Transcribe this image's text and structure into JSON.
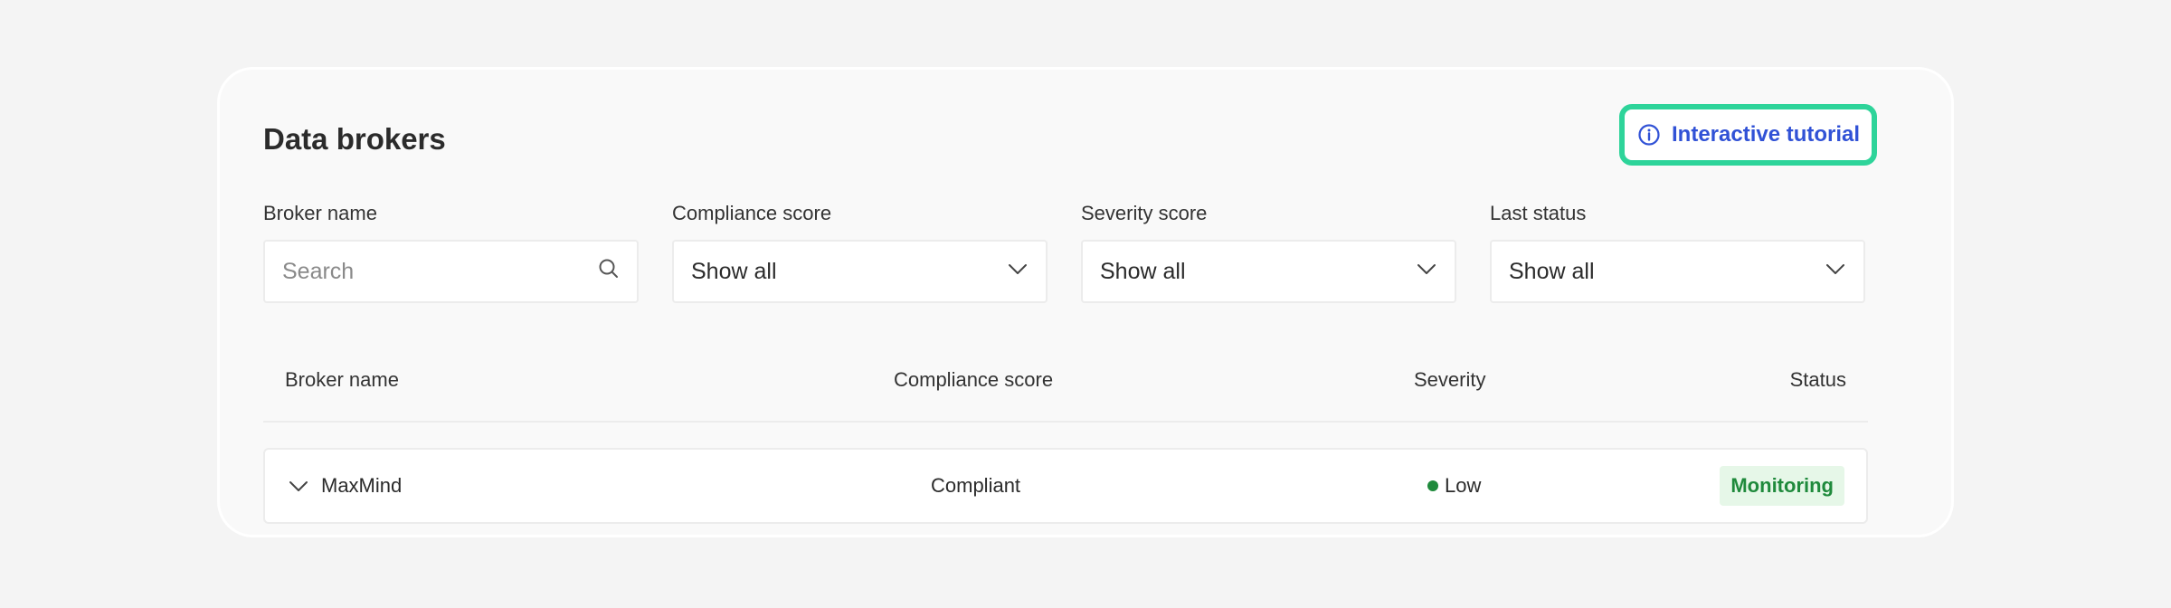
{
  "page": {
    "title": "Data brokers",
    "tutorial_label": "Interactive tutorial"
  },
  "filters": [
    {
      "label": "Broker name",
      "placeholder": "Search",
      "icon": "search-icon"
    },
    {
      "label": "Compliance score",
      "value": "Show all",
      "icon": "chevron-down-icon"
    },
    {
      "label": "Severity score",
      "value": "Show all",
      "icon": "chevron-down-icon"
    },
    {
      "label": "Last status",
      "value": "Show all",
      "icon": "chevron-down-icon"
    }
  ],
  "table": {
    "columns": [
      "Broker name",
      "Compliance score",
      "Severity",
      "Status"
    ],
    "rows": [
      {
        "broker": "MaxMind",
        "compliance": "Compliant",
        "severity": "Low",
        "status": "Monitoring"
      }
    ]
  },
  "colors": {
    "accent": "#3152d6",
    "tutorial_border": "#2ed49a",
    "status_green": "#1f8a3c",
    "status_bg": "#e6f7e8"
  }
}
